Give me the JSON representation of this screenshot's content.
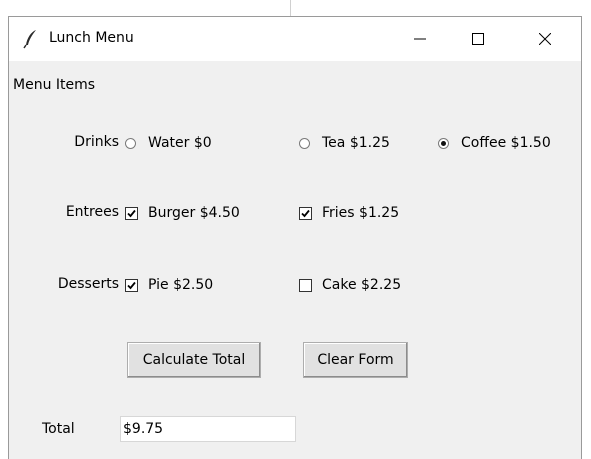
{
  "window": {
    "title": "Lunch Menu",
    "icon": "feather-icon",
    "controls": {
      "minimize": "minimize-icon",
      "maximize": "maximize-icon",
      "close": "close-icon"
    }
  },
  "menu": {
    "heading": "Menu Items",
    "drinks": {
      "label": "Drinks",
      "options": [
        {
          "label": "Water $0",
          "selected": false
        },
        {
          "label": "Tea $1.25",
          "selected": false
        },
        {
          "label": "Coffee $1.50",
          "selected": true
        }
      ]
    },
    "entrees": {
      "label": "Entrees",
      "options": [
        {
          "label": "Burger $4.50",
          "checked": true
        },
        {
          "label": "Fries $1.25",
          "checked": true
        }
      ]
    },
    "desserts": {
      "label": "Desserts",
      "options": [
        {
          "label": "Pie $2.50",
          "checked": true
        },
        {
          "label": "Cake $2.25",
          "checked": false
        }
      ]
    }
  },
  "buttons": {
    "calculate": "Calculate Total",
    "clear": "Clear Form"
  },
  "total": {
    "label": "Total",
    "value": "$9.75"
  }
}
